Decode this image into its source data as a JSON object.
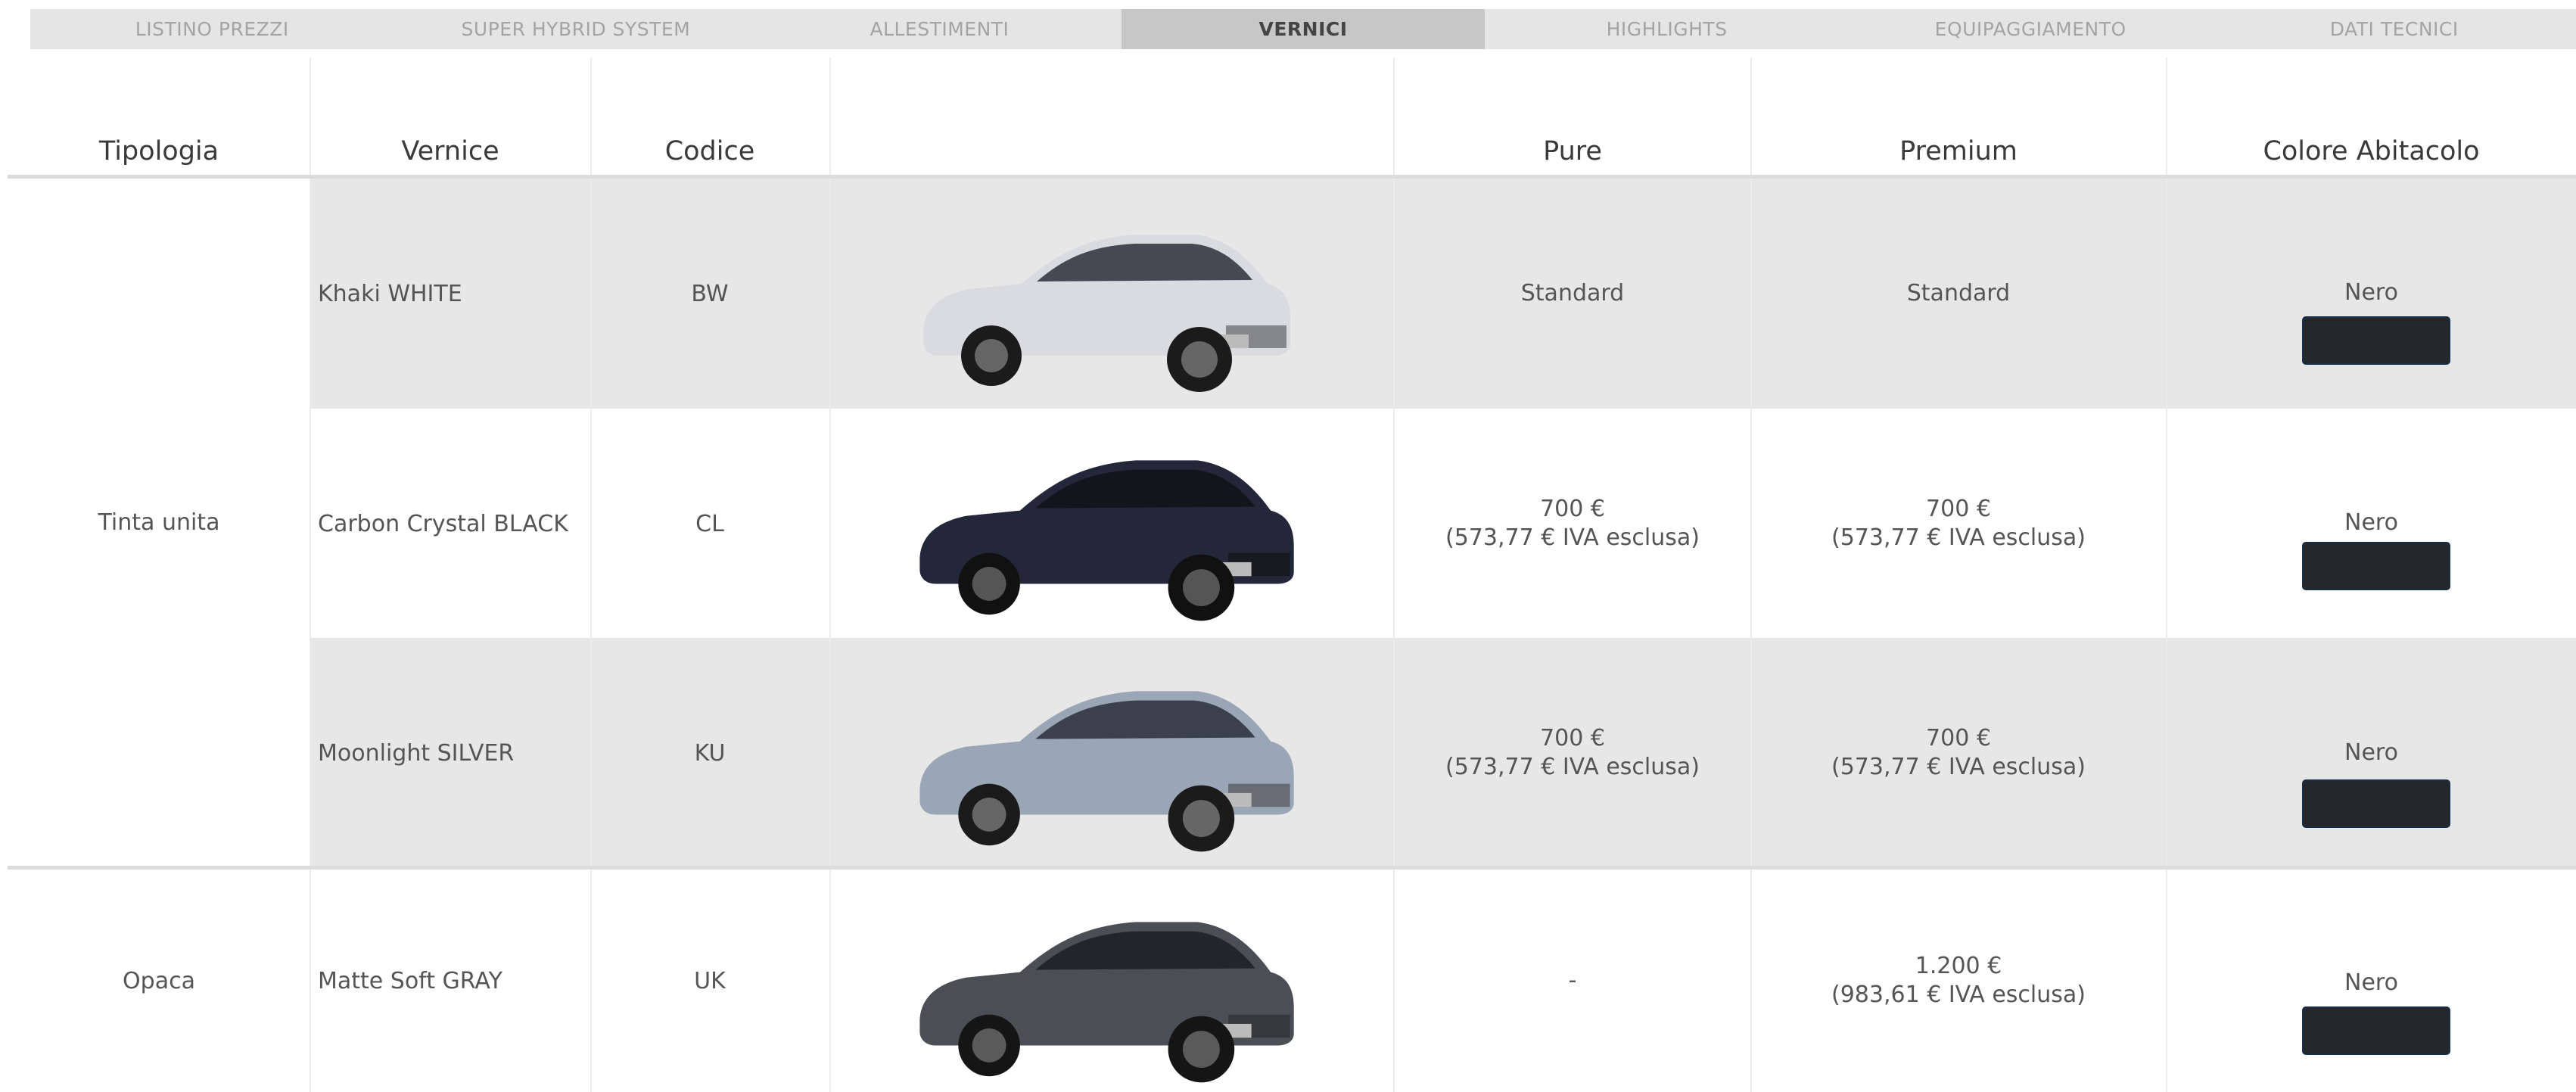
{
  "tabs": [
    {
      "label": "LISTINO PREZZI"
    },
    {
      "label": "SUPER HYBRID SYSTEM"
    },
    {
      "label": "ALLESTIMENTI"
    },
    {
      "label": "VERNICI"
    },
    {
      "label": "HIGHLIGHTS"
    },
    {
      "label": "EQUIPAGGIAMENTO"
    },
    {
      "label": "DATI TECNICI"
    }
  ],
  "active_tab": "VERNICI",
  "headers": {
    "tipologia": "Tipologia",
    "vernice": "Vernice",
    "codice": "Codice",
    "pure": "Pure",
    "premium": "Premium",
    "colore_abitacolo": "Colore Abitacolo"
  },
  "groups": [
    {
      "label": "Tinta unita"
    },
    {
      "label": "Opaca"
    }
  ],
  "rows": [
    {
      "vernice": "Khaki WHITE",
      "codice": "BW",
      "pure": "Standard",
      "pure_sub": "",
      "premium": "Standard",
      "premium_sub": "",
      "abitacolo": "Nero",
      "car_color": "#d9dbe0"
    },
    {
      "vernice": "Carbon Crystal BLACK",
      "codice": "CL",
      "pure": "700 €",
      "pure_sub": "(573,77 € IVA esclusa)",
      "premium": "700 €",
      "premium_sub": "(573,77 € IVA esclusa)",
      "abitacolo": "Nero",
      "car_color": "#22283a"
    },
    {
      "vernice": "Moonlight SILVER",
      "codice": "KU",
      "pure": "700 €",
      "pure_sub": "(573,77 € IVA esclusa)",
      "premium": "700 €",
      "premium_sub": "(573,77 € IVA esclusa)",
      "abitacolo": "Nero",
      "car_color": "#9aa6b6"
    },
    {
      "vernice": "Matte Soft GRAY",
      "codice": "UK",
      "pure": "-",
      "pure_sub": "",
      "premium": "1.200 €",
      "premium_sub": "(983,61 € IVA esclusa)",
      "abitacolo": "Nero",
      "car_color": "#4a4e55"
    }
  ],
  "colors": {
    "row_shade": "#e7e7e7",
    "swatch": "#25272b",
    "active_tab_bg": "#c7c7c7"
  }
}
